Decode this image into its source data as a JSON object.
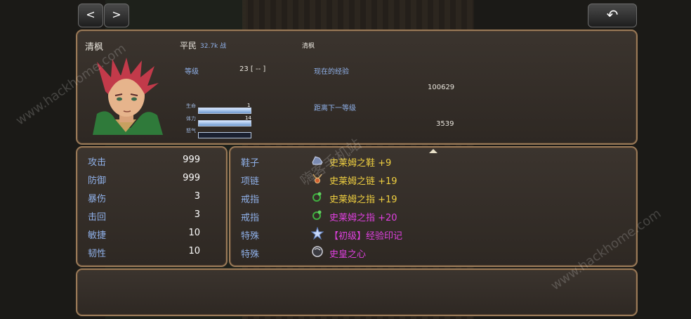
{
  "nav": {
    "prev": "<",
    "next": ">",
    "back": "↶"
  },
  "header": {
    "name": "清枫",
    "rank": "平民",
    "power": "32.7k 战",
    "title_name": "清枫"
  },
  "status": {
    "level_label": "等级",
    "level_value": "23 [ -- ]",
    "exp_label": "现在的经验",
    "exp_value": "100629",
    "next_label": "距离下一等级",
    "next_value": "3539",
    "bars": [
      {
        "label": "生命",
        "value": "1",
        "fill": 1.0
      },
      {
        "label": "体力",
        "value": "14",
        "fill": 1.0
      },
      {
        "label": "怒气",
        "value": "",
        "fill": 0.0
      }
    ]
  },
  "stats": [
    {
      "name": "攻击",
      "value": "999"
    },
    {
      "name": "防御",
      "value": "999"
    },
    {
      "name": "暴伤",
      "value": "3"
    },
    {
      "name": "击回",
      "value": "3"
    },
    {
      "name": "敏捷",
      "value": "10"
    },
    {
      "name": "韧性",
      "value": "10"
    }
  ],
  "equipment": [
    {
      "slot": "鞋子",
      "item": "史莱姆之鞋 +9",
      "color": "#f0d040",
      "icon": "boots-icon"
    },
    {
      "slot": "项链",
      "item": "史莱姆之链 +19",
      "color": "#f0d040",
      "icon": "necklace-icon"
    },
    {
      "slot": "戒指",
      "item": "史莱姆之指 +19",
      "color": "#f0d040",
      "icon": "ring-icon"
    },
    {
      "slot": "戒指",
      "item": "史莱姆之指 +20",
      "color": "#e040e0",
      "icon": "ring-icon"
    },
    {
      "slot": "特殊",
      "item": "【初级】经验印记",
      "color": "#e040e0",
      "icon": "star-icon"
    },
    {
      "slot": "特殊",
      "item": "史皇之心",
      "color": "#e040e0",
      "icon": "orb-icon"
    }
  ],
  "watermarks": [
    "www.hackhome.com",
    "嗨客手机站",
    "www.hackhome.com"
  ]
}
